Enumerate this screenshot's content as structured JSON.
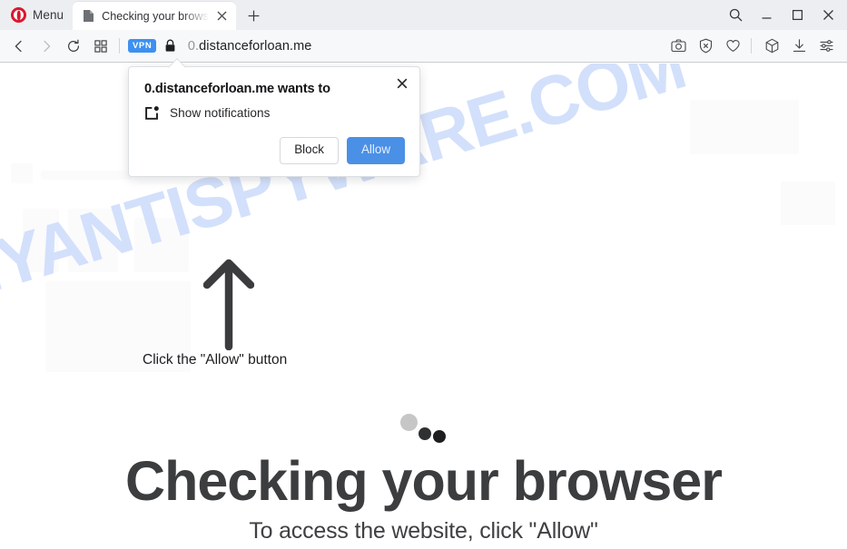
{
  "browser": {
    "menu_label": "Menu",
    "tab": {
      "title": "Checking your browser",
      "favicon": "page-icon",
      "close_icon": "close-icon"
    },
    "new_tab_icon": "plus-icon",
    "window_controls": [
      {
        "name": "search-icon",
        "label": ""
      },
      {
        "name": "minimize-icon",
        "label": ""
      },
      {
        "name": "maximize-icon",
        "label": ""
      },
      {
        "name": "close-window-icon",
        "label": ""
      }
    ]
  },
  "addressbar": {
    "back_icon": "back-arrow-icon",
    "forward_icon": "forward-arrow-icon",
    "reload_icon": "reload-icon",
    "tab_overview_icon": "grid-icon",
    "vpn_badge": "VPN",
    "lock_icon": "lock-icon",
    "url_scheme": "0.",
    "url_host": "distanceforloan.me",
    "url_full": "0.distanceforloan.me",
    "actions": [
      {
        "name": "snapshot-icon"
      },
      {
        "name": "ad-blocker-icon"
      },
      {
        "name": "heart-icon"
      },
      {
        "name": "pods-icon"
      },
      {
        "name": "downloads-icon"
      },
      {
        "name": "easy-setup-icon"
      }
    ]
  },
  "permission_dialog": {
    "title": "0.distanceforloan.me wants to",
    "request_icon": "notification-icon",
    "request_text": "Show notifications",
    "block_label": "Block",
    "allow_label": "Allow",
    "close_icon": "close-icon",
    "allow_color": "#4a90e6"
  },
  "page": {
    "arrow_icon": "up-arrow-icon",
    "hint": "Click the \"Allow\" button",
    "headline": "Checking your browser",
    "subline": "To access the website, click \"Allow\"",
    "watermark": "MYANTISPYWARE.COM",
    "watermark_color": "#d3e0fb",
    "loading_dots": 3
  }
}
